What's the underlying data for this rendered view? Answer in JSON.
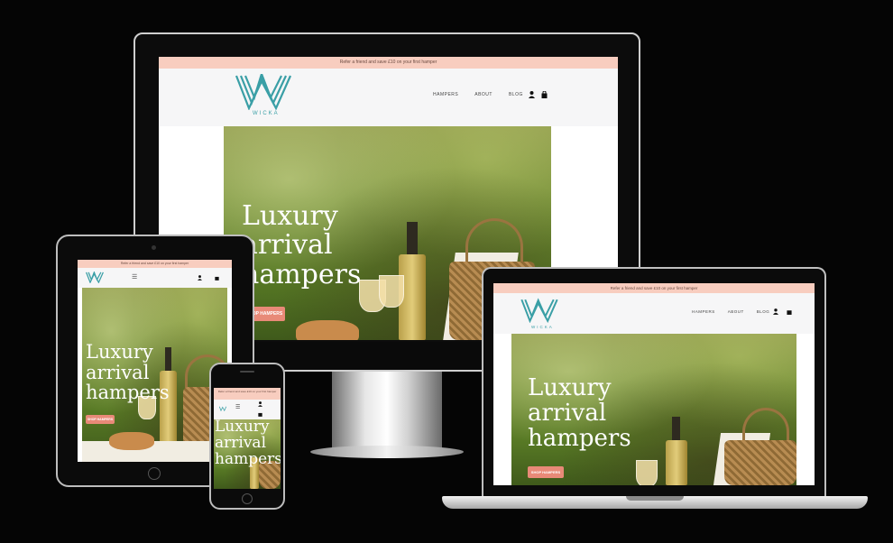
{
  "site": {
    "promo_text": "Refer a friend and save £10 on your first hamper",
    "brand_name": "WICKA",
    "logo_letter": "W",
    "nav": [
      "HAMPERS",
      "ABOUT",
      "BLOG"
    ],
    "hero_lines": [
      "Luxury",
      "arrival",
      "hampers"
    ],
    "cta_label": "SHOP HAMPERS",
    "hamburger": "☰",
    "account_icon": "user-icon",
    "bag_icon": "shopping-bag-icon"
  },
  "colors": {
    "promo_bg": "#f8cdbf",
    "brand_teal": "#3a9fa6",
    "cta": "#e88a78",
    "background": "#050505"
  }
}
